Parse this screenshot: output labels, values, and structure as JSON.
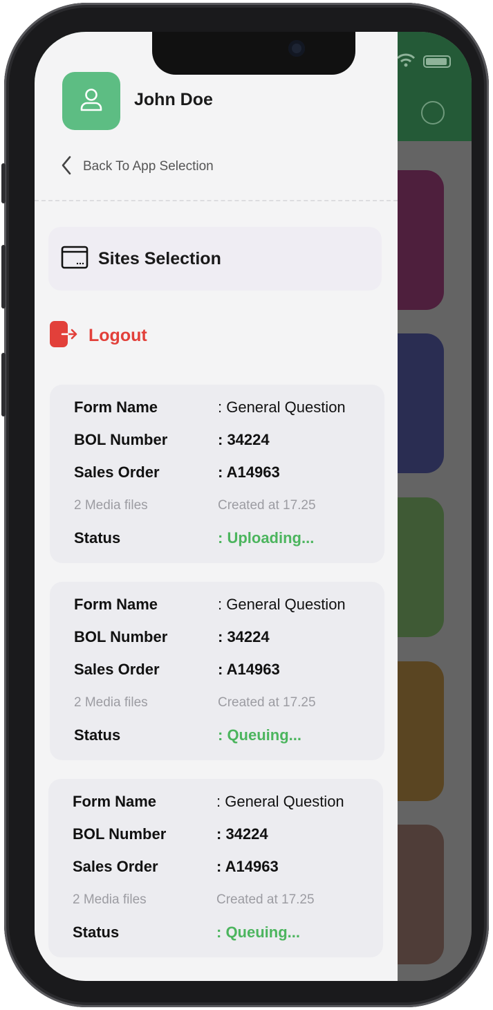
{
  "drawer": {
    "user_name": "John Doe",
    "back_label": "Back To App Selection",
    "sites_label": "Sites Selection",
    "logout_label": "Logout"
  },
  "submissions": [
    {
      "form_name_label": "Form Name",
      "form_name_value": ": General Question",
      "bol_label": "BOL Number",
      "bol_value": ": 34224",
      "sales_label": "Sales Order",
      "sales_value": ": A14963",
      "media_text": "2 Media files",
      "created_text": "Created at 17.25",
      "status_label": "Status",
      "status_value": ": Uploading..."
    },
    {
      "form_name_label": "Form Name",
      "form_name_value": ": General Question",
      "bol_label": "BOL Number",
      "bol_value": ": 34224",
      "sales_label": "Sales Order",
      "sales_value": ": A14963",
      "media_text": "2 Media files",
      "created_text": "Created at 17.25",
      "status_label": "Status",
      "status_value": ": Queuing..."
    },
    {
      "form_name_label": "Form Name",
      "form_name_value": ": General Question",
      "bol_label": "BOL Number",
      "bol_value": ": 34224",
      "sales_label": "Sales Order",
      "sales_value": ": A14963",
      "media_text": "2 Media files",
      "created_text": "Created at 17.25",
      "status_label": "Status",
      "status_value": ": Queuing..."
    }
  ],
  "colors": {
    "accent_green": "#5dbd83",
    "status_green": "#4cb55e",
    "logout_red": "#e2403a",
    "header_green": "#245a37"
  },
  "icons": [
    "user-icon",
    "chevron-left-icon",
    "window-icon",
    "logout-icon",
    "wifi-icon",
    "battery-icon"
  ]
}
